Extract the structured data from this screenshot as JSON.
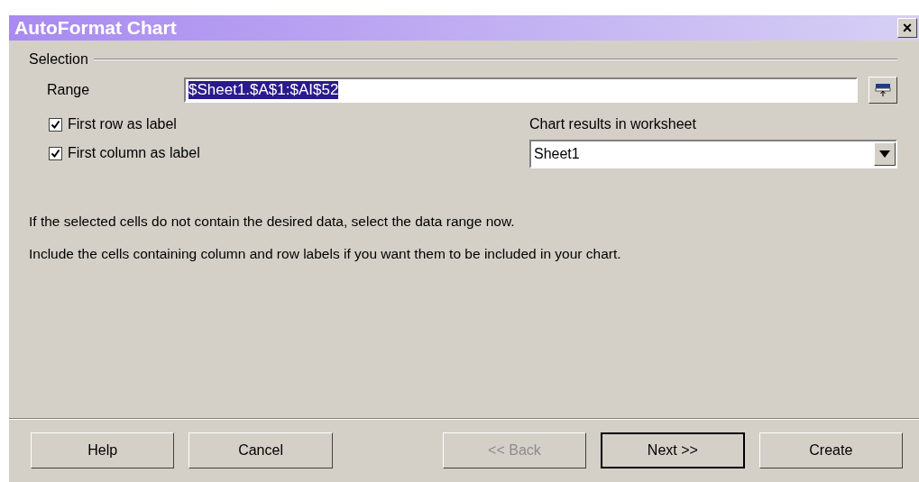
{
  "window": {
    "title": "AutoFormat Chart",
    "close": "×"
  },
  "selection": {
    "legend": "Selection",
    "range": {
      "label": "Range",
      "value": "$Sheet1.$A$1:$AI$52",
      "selected": true
    },
    "checkboxes": [
      {
        "label": "First row as label",
        "checked": true
      },
      {
        "label": "First column as label",
        "checked": true
      }
    ],
    "worksheet": {
      "label": "Chart results in worksheet",
      "value": "Sheet1"
    }
  },
  "hints": [
    "If the selected cells do not contain the desired data, select the data range now.",
    "Include the cells containing column and row labels if you want them to be included in your chart."
  ],
  "buttons": [
    {
      "label": "Help",
      "disabled": false,
      "default": false
    },
    {
      "label": "Cancel",
      "disabled": false,
      "default": false
    },
    {
      "label": "<< Back",
      "disabled": true,
      "default": false
    },
    {
      "label": "Next >>",
      "disabled": false,
      "default": true
    },
    {
      "label": "Create",
      "disabled": false,
      "default": false
    }
  ]
}
